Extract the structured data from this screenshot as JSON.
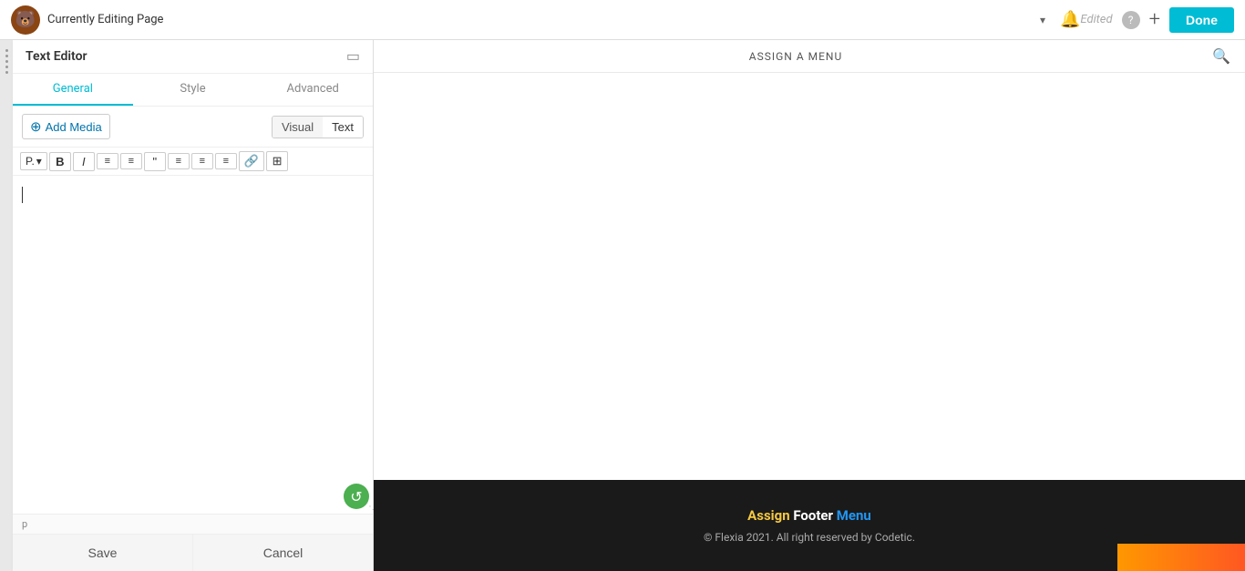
{
  "topbar": {
    "logo_emoji": "🐻",
    "title": "Currently Editing Page",
    "chevron": "▾",
    "bell_icon": "🔔",
    "edited_label": "Edited",
    "help_icon": "?",
    "plus_icon": "+",
    "done_label": "Done"
  },
  "panel": {
    "title": "Text Editor",
    "minimize_icon": "▭",
    "tabs": [
      {
        "label": "General",
        "active": true
      },
      {
        "label": "Style",
        "active": false
      },
      {
        "label": "Advanced",
        "active": false
      }
    ],
    "add_media_label": "Add Media",
    "add_media_icon": "⊕",
    "toggle_visual": "Visual",
    "toggle_text": "Text",
    "format_buttons": [
      "P ▾",
      "B",
      "I",
      "≡",
      "≡",
      "❝",
      "≡",
      "≡",
      "≡",
      "🔗",
      "⊞"
    ],
    "paragraph_label": "p",
    "refresh_icon": "↺",
    "save_label": "Save",
    "cancel_label": "Cancel"
  },
  "page": {
    "assign_menu_label": "ASSIGN A MENU",
    "search_icon": "🔍"
  },
  "footer": {
    "assign_footer_menu": "Assign Footer Menu",
    "copyright": "© Flexia 2021. All right reserved by Codetic."
  }
}
